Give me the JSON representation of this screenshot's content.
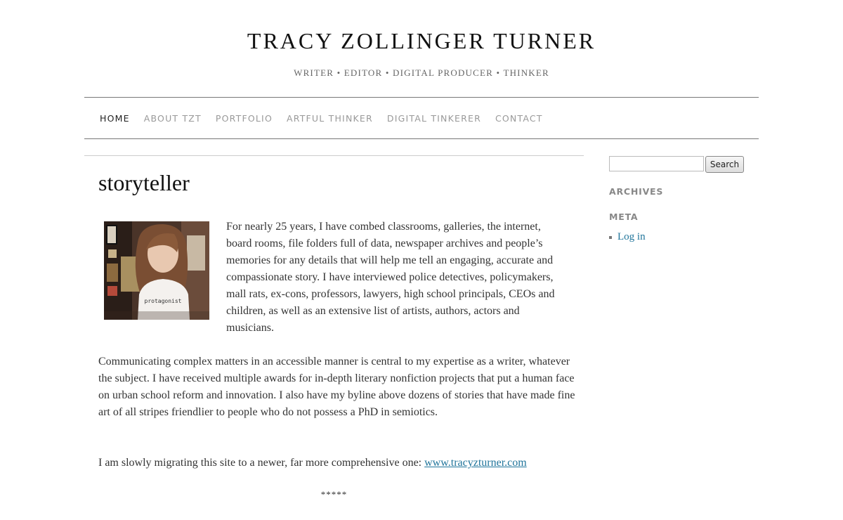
{
  "site": {
    "title": "TRACY ZOLLINGER TURNER",
    "description": "WRITER • EDITOR • DIGITAL PRODUCER • THINKER"
  },
  "nav": {
    "items": [
      {
        "label": "HOME",
        "active": true
      },
      {
        "label": "ABOUT TZT",
        "active": false
      },
      {
        "label": "PORTFOLIO",
        "active": false
      },
      {
        "label": "ARTFUL THINKER",
        "active": false
      },
      {
        "label": "DIGITAL TINKERER",
        "active": false
      },
      {
        "label": "CONTACT",
        "active": false
      }
    ]
  },
  "main": {
    "page_title": "storyteller",
    "photo_shirt_text": "protagonist",
    "paragraphs": [
      "For nearly 25 years, I have combed classrooms, galleries, the internet, board rooms, file folders full of data, newspaper archives and people’s memories for any details that will help me tell an engaging, accurate and compassionate story. I have interviewed police detectives, policymakers, mall rats, ex-cons, professors, lawyers, high school principals, CEOs and children, as well as an extensive list of artists, authors, actors and musicians.",
      "Communicating complex matters in an accessible manner is central to my expertise as a writer, whatever the subject. I have received multiple awards for in-depth literary nonfiction projects that put a human face on urban school reform and innovation. I also have my byline above dozens of stories that have made fine art of all stripes friendlier to people who do not possess a PhD in semiotics.",
      "I am slowly migrating this site to a newer, far more comprehensive one: "
    ],
    "link_text": "www.tracyzturner.com",
    "separator": "*****"
  },
  "sidebar": {
    "search_value": "",
    "search_button": "Search",
    "archives_title": "ARCHIVES",
    "meta_title": "META",
    "meta_items": [
      "Log in"
    ]
  },
  "colors": {
    "link": "#21759b",
    "nav_active": "#222222",
    "nav_inactive": "#999999",
    "widget_title": "#888888"
  }
}
